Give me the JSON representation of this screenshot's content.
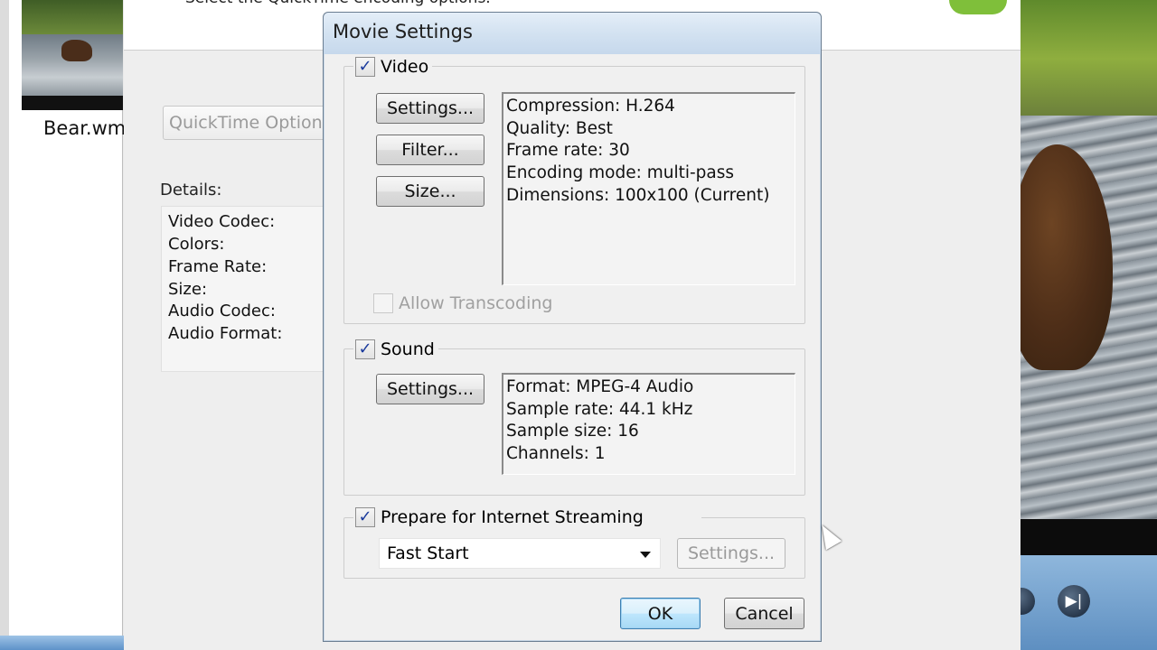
{
  "background": {
    "top_text": "Select the QuickTime encoding options.",
    "thumbnail_label": "Bear.wm",
    "quicktime_options_label": "QuickTime Options...",
    "details_label": "Details:",
    "details_rows": [
      "Video Codec:",
      "Colors:",
      "Frame Rate:",
      "Size:",
      "Audio Codec:",
      "Audio Format:"
    ]
  },
  "dialog": {
    "title": "Movie Settings",
    "video": {
      "label": "Video",
      "checked": true,
      "settings_button": "Settings...",
      "filter_button": "Filter...",
      "size_button": "Size...",
      "info": [
        "Compression: H.264",
        "Quality: Best",
        "Frame rate: 30",
        "Encoding mode: multi-pass",
        "Dimensions: 100x100 (Current)"
      ],
      "allow_transcoding": "Allow Transcoding"
    },
    "sound": {
      "label": "Sound",
      "checked": true,
      "settings_button": "Settings...",
      "info": [
        "Format: MPEG-4 Audio",
        "Sample rate: 44.1 kHz",
        "Sample size: 16",
        "Channels: 1"
      ]
    },
    "streaming": {
      "label": "Prepare for Internet Streaming",
      "checked": true,
      "selected_option": "Fast Start",
      "settings_button": "Settings..."
    },
    "ok_button": "OK",
    "cancel_button": "Cancel"
  },
  "colors": {
    "accent": "#3c7fb1",
    "checkmark": "#1a3a9c",
    "titlebar": "#d3e2f1"
  }
}
